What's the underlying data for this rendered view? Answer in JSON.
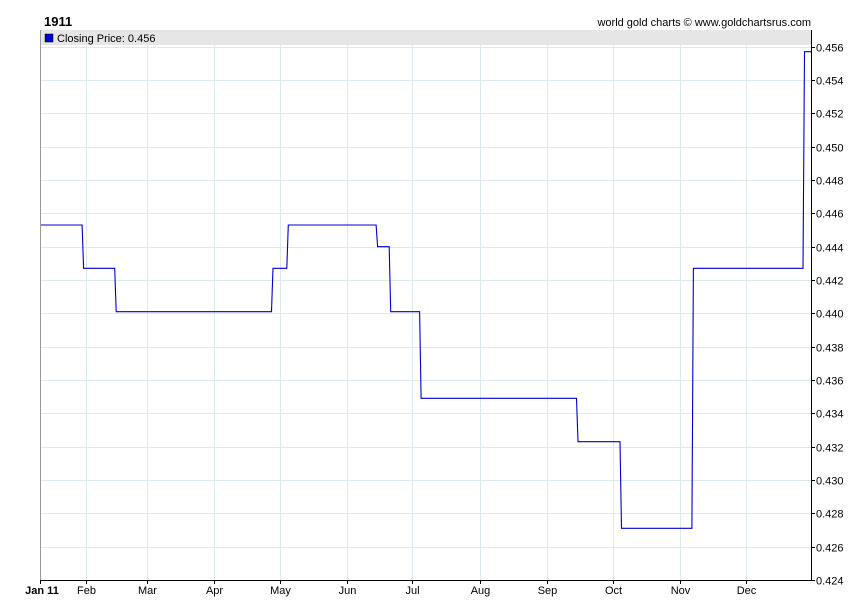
{
  "header": {
    "title": "1911",
    "credit": "world gold charts © www.goldchartsrus.com"
  },
  "legend": {
    "label": "Closing Price: 0.456",
    "swatch_color": "#0000cc"
  },
  "colors": {
    "line": "#0000cc",
    "grid": "#dde9ec",
    "legend_band": "#e6e6e6",
    "axis": "#000000"
  },
  "chart_data": {
    "type": "line",
    "title": "1911",
    "xlabel": "",
    "ylabel": "",
    "ylim": [
      0.424,
      0.457
    ],
    "y_ticks": [
      "0.424",
      "0.426",
      "0.428",
      "0.430",
      "0.432",
      "0.434",
      "0.436",
      "0.438",
      "0.440",
      "0.442",
      "0.444",
      "0.446",
      "0.448",
      "0.450",
      "0.452",
      "0.454",
      "0.456"
    ],
    "x_ticks": [
      "Jan 11",
      "Feb",
      "Mar",
      "Apr",
      "May",
      "Jun",
      "Jul",
      "Aug",
      "Sep",
      "Oct",
      "Nov",
      "Dec"
    ],
    "x_tick_dates": [
      "1911-01-11",
      "1911-02-01",
      "1911-03-01",
      "1911-04-01",
      "1911-05-01",
      "1911-06-01",
      "1911-07-01",
      "1911-08-01",
      "1911-09-01",
      "1911-10-01",
      "1911-11-01",
      "1911-12-01"
    ],
    "x_range": [
      "1911-01-11",
      "1911-12-31"
    ],
    "grid": true,
    "legend_position": "top-left",
    "series": [
      {
        "name": "Closing Price",
        "step": true,
        "points": [
          {
            "x": "1911-01-11",
            "y": 0.4453
          },
          {
            "x": "1911-01-31",
            "y": 0.4427
          },
          {
            "x": "1911-02-15",
            "y": 0.4401
          },
          {
            "x": "1911-04-28",
            "y": 0.4427
          },
          {
            "x": "1911-05-05",
            "y": 0.4453
          },
          {
            "x": "1911-06-15",
            "y": 0.444
          },
          {
            "x": "1911-06-21",
            "y": 0.4401
          },
          {
            "x": "1911-07-05",
            "y": 0.4349
          },
          {
            "x": "1911-09-15",
            "y": 0.4323
          },
          {
            "x": "1911-10-05",
            "y": 0.4271
          },
          {
            "x": "1911-11-07",
            "y": 0.4427
          },
          {
            "x": "1911-12-28",
            "y": 0.4557
          }
        ],
        "end_x": "1911-12-31"
      }
    ]
  }
}
